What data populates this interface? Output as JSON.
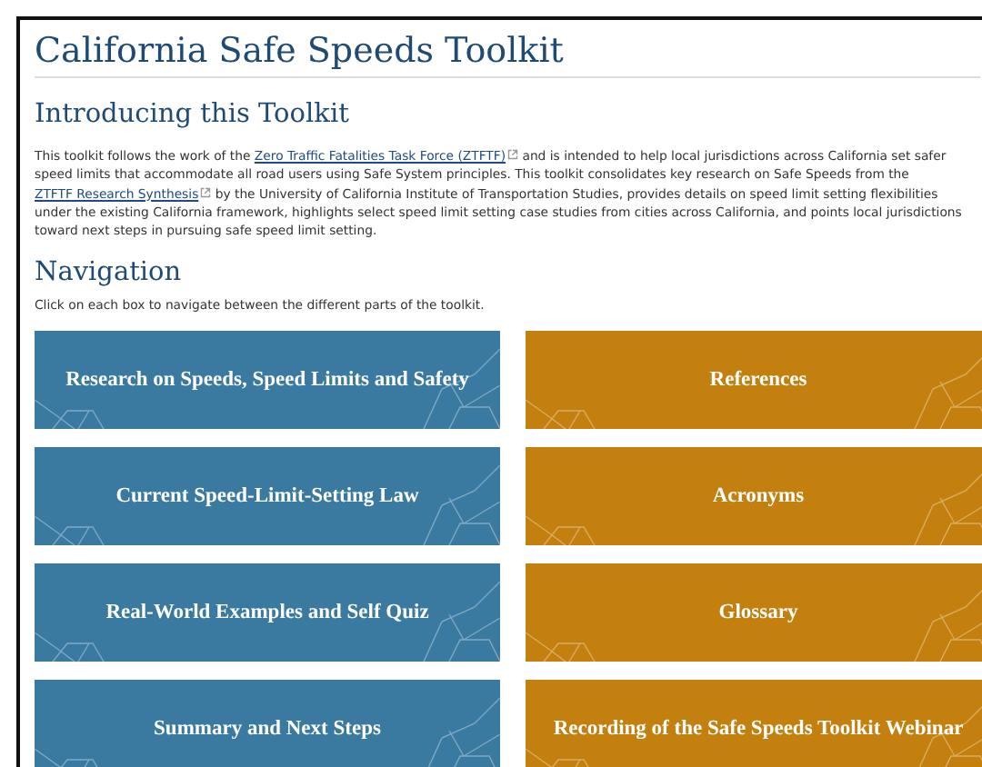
{
  "page_title": "California Safe Speeds Toolkit",
  "intro": {
    "heading": "Introducing this Toolkit",
    "parts": [
      {
        "kind": "text",
        "text": "This toolkit follows the work of the "
      },
      {
        "kind": "link",
        "text": "Zero Traffic Fatalities Task Force (ZTFTF)"
      },
      {
        "kind": "text",
        "text": " and is intended to help local jurisdictions across California set safer speed limits that accommodate all road users using Safe System principles. This toolkit consolidates key research on Safe Speeds from the "
      },
      {
        "kind": "link",
        "text": "ZTFTF Research Synthesis"
      },
      {
        "kind": "text",
        "text": " by the University of California Institute of Transportation Studies, provides details on speed limit setting flexibilities under the existing California framework, highlights select speed limit setting case studies from cities across California, and points local jurisdictions toward next steps in pursuing safe speed limit setting."
      }
    ]
  },
  "navigation": {
    "heading": "Navigation",
    "hint": "Click on each box to navigate between the different parts of the toolkit.",
    "tiles": [
      {
        "label": "Research on Speeds, Speed Limits and Safety",
        "color": "#3a7aa0"
      },
      {
        "label": "References",
        "color": "#c3800f"
      },
      {
        "label": "Current Speed-Limit-Setting Law",
        "color": "#3a7aa0"
      },
      {
        "label": "Acronyms",
        "color": "#c3800f"
      },
      {
        "label": "Real-World Examples and Self Quiz",
        "color": "#3a7aa0"
      },
      {
        "label": "Glossary",
        "color": "#c3800f"
      },
      {
        "label": "Summary and Next Steps",
        "color": "#3a7aa0"
      },
      {
        "label": "Recording of the Safe Speeds Toolkit Webinar",
        "color": "#c3800f"
      }
    ]
  }
}
